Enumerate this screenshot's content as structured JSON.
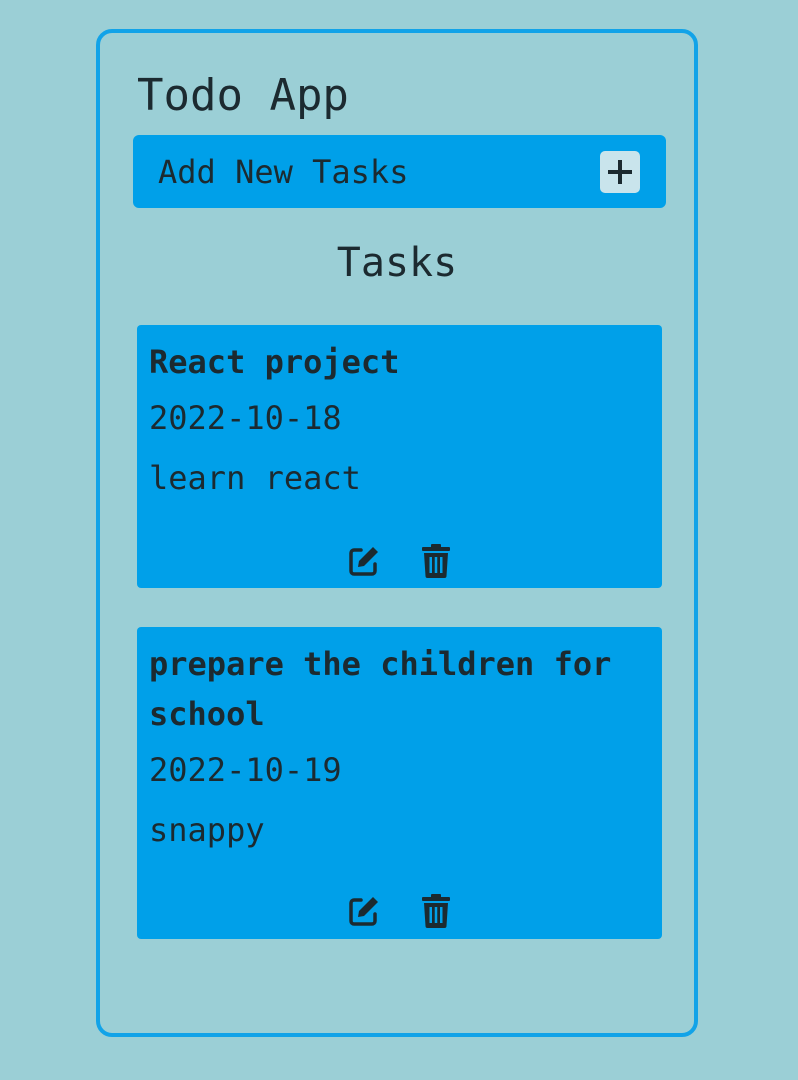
{
  "app": {
    "title": "Todo App",
    "add_label": "Add New Tasks",
    "add_icon": "plus-icon",
    "tasks_heading": "Tasks"
  },
  "colors": {
    "page_background": "#9bcfd6",
    "frame_border": "#12a3e8",
    "card_background": "#00a0e9",
    "text": "#1c2a30"
  },
  "tasks": [
    {
      "title": "React project",
      "date": "2022-10-18",
      "description": "learn react",
      "edit_icon": "edit-icon",
      "delete_icon": "trash-icon"
    },
    {
      "title": "prepare the children for school",
      "date": "2022-10-19",
      "description": "snappy",
      "edit_icon": "edit-icon",
      "delete_icon": "trash-icon"
    }
  ]
}
